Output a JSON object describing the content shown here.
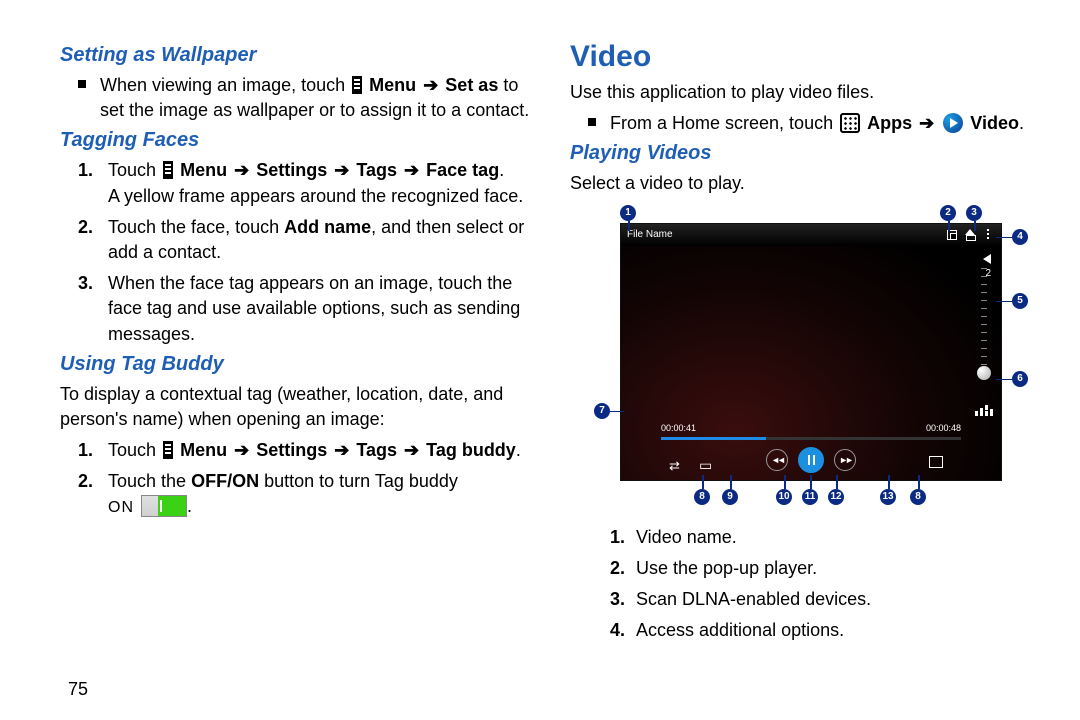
{
  "page_number": "75",
  "left": {
    "h_wallpaper": "Setting as Wallpaper",
    "wallpaper_b1a": "When viewing an image, touch",
    "wallpaper_b1b": "Menu",
    "wallpaper_b1c": "Set as",
    "wallpaper_b1d": "to set the image as wallpaper or to assign it to a contact.",
    "h_tagging": "Tagging Faces",
    "tag_n1a": "Touch",
    "tag_n1b": "Menu",
    "tag_n1c": "Settings",
    "tag_n1d": "Tags",
    "tag_n1e": "Face tag",
    "tag_n1f": "A yellow frame appears around the recognized face.",
    "tag_n2a": "Touch the face, touch",
    "tag_n2b": "Add name",
    "tag_n2c": ", and then select or add a contact.",
    "tag_n3": "When the face tag appears on an image, touch the face tag and use available options, such as sending messages.",
    "h_buddy": "Using Tag Buddy",
    "buddy_intro": "To display a contextual tag (weather, location, date, and person's name) when opening an image:",
    "buddy_n1a": "Touch",
    "buddy_n1b": "Menu",
    "buddy_n1c": "Settings",
    "buddy_n1d": "Tags",
    "buddy_n1e": "Tag buddy",
    "buddy_n2a": "Touch the",
    "buddy_n2b": "OFF/ON",
    "buddy_n2c": "button to turn Tag buddy",
    "buddy_on": "ON"
  },
  "right": {
    "h_video": "Video",
    "video_intro": "Use this application to play video files.",
    "video_b1a": "From a Home screen, touch",
    "video_b1b": "Apps",
    "video_b1c": "Video",
    "h_playing": "Playing Videos",
    "playing_intro": "Select a video to play.",
    "player_title": "File Name",
    "t_elapsed": "00:00:41",
    "t_total": "00:00:48",
    "vol_level": "2",
    "list": {
      "n1": "Video name.",
      "n2": "Use the pop-up player.",
      "n3": "Scan DLNA-enabled devices.",
      "n4": "Access additional options."
    }
  }
}
